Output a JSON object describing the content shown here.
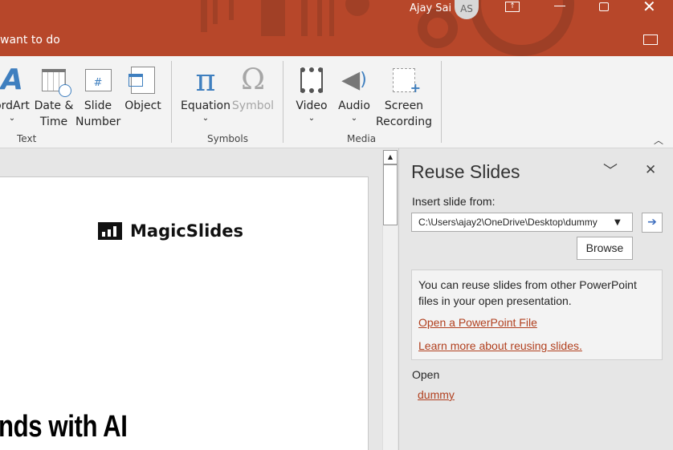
{
  "titlebar": {
    "tell_me": "want to do",
    "user_name": "Ajay Sai",
    "user_initials": "AS",
    "accent": "#b7472a"
  },
  "ribbon": {
    "groups": [
      {
        "label": "Text",
        "buttons": [
          {
            "label": "ordArt"
          },
          {
            "label": "Date &",
            "label2": "Time"
          },
          {
            "label": "Slide",
            "label2": "Number"
          },
          {
            "label": "Object"
          }
        ]
      },
      {
        "label": "Symbols",
        "buttons": [
          {
            "label": "Equation"
          },
          {
            "label": "Symbol"
          }
        ]
      },
      {
        "label": "Media",
        "buttons": [
          {
            "label": "Video"
          },
          {
            "label": "Audio"
          },
          {
            "label": "Screen",
            "label2": "Recording"
          }
        ]
      }
    ]
  },
  "slide": {
    "logo_text": "MagicSlides",
    "title_fragment": "nds with AI"
  },
  "pane": {
    "title": "Reuse Slides",
    "insert_label": "Insert slide from:",
    "path_value": "C:\\Users\\ajay2\\OneDrive\\Desktop\\dummy",
    "browse_label": "Browse",
    "info_text": "You can reuse slides from other PowerPoint files in your open presentation.",
    "link_open": "Open a PowerPoint File",
    "link_learn": "Learn more about reusing slides.",
    "open_label": "Open",
    "open_file": "dummy"
  }
}
